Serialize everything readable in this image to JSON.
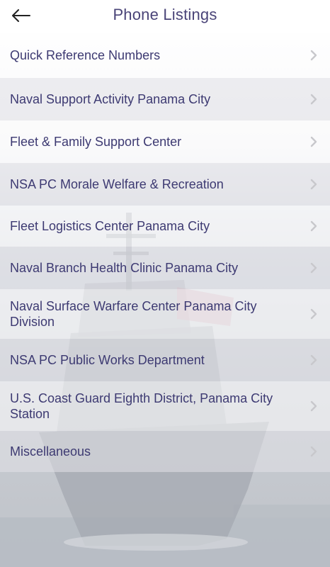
{
  "header": {
    "title": "Phone Listings"
  },
  "list": {
    "items": [
      {
        "label": "Quick Reference Numbers"
      },
      {
        "label": "Naval Support Activity Panama City"
      },
      {
        "label": "Fleet & Family Support Center"
      },
      {
        "label": "NSA PC Morale Welfare & Recreation"
      },
      {
        "label": "Fleet Logistics Center Panama City"
      },
      {
        "label": "Naval Branch Health Clinic Panama City"
      },
      {
        "label": "Naval Surface Warfare Center Panama City Division"
      },
      {
        "label": "NSA PC Public Works Department"
      },
      {
        "label": "U.S. Coast Guard Eighth District, Panama City Station"
      },
      {
        "label": "Miscellaneous"
      }
    ]
  },
  "colors": {
    "accent": "#4a4478",
    "text": "#3d3a72",
    "chevron": "#c8c8cc"
  },
  "icons": {
    "back": "arrow-left-icon",
    "row": "chevron-right-icon",
    "background": "navy-ship-image"
  }
}
